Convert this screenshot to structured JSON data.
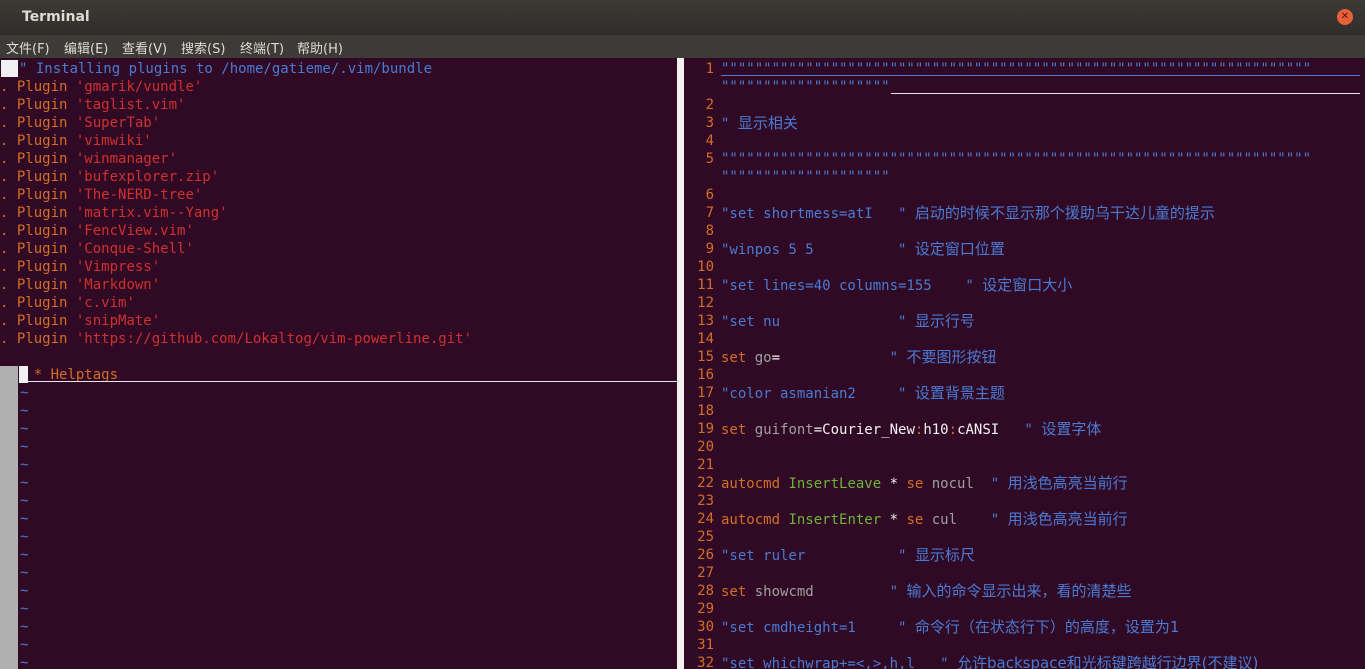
{
  "window": {
    "title": "Terminal"
  },
  "menu": [
    "文件(F)",
    "编辑(E)",
    "查看(V)",
    "搜索(S)",
    "终端(T)",
    "帮助(H)"
  ],
  "left_pane": {
    "header": "\" Installing plugins to /home/gatieme/.vim/bundle",
    "plugins": [
      "'gmarik/vundle'",
      "'taglist.vim'",
      "'SuperTab'",
      "'vimwiki'",
      "'winmanager'",
      "'bufexplorer.zip'",
      "'The-NERD-tree'",
      "'matrix.vim--Yang'",
      "'FencView.vim'",
      "'Conque-Shell'",
      "'Vimpress'",
      "'Markdown'",
      "'c.vim'",
      "'snipMate'",
      "'https://github.com/Lokaltog/vim-powerline.git'"
    ],
    "plugin_prefix": ". ",
    "plugin_keyword": "Plugin",
    "helptags_prefix": "* ",
    "helptags": "Helptags",
    "tilde": "~"
  },
  "right_pane": {
    "sep_a": "\"\"\"\"\"\"\"\"\"\"\"\"\"\"\"\"\"\"\"\"\"\"\"\"\"\"\"\"\"\"\"\"\"\"\"\"\"\"\"\"\"\"\"\"\"\"\"\"\"\"\"\"\"\"\"\"\"\"\"\"\"\"\"\"\"\"\"\"\"\"",
    "sep_b": "\"\"\"\"\"\"\"\"\"\"\"\"\"\"\"\"\"\"\"\"",
    "lines": [
      {
        "n": "1"
      },
      {
        "n": "2"
      },
      {
        "n": "3",
        "code": "\" ",
        "cn": "显示相关"
      },
      {
        "n": "4"
      },
      {
        "n": "5"
      },
      {
        "n": "6"
      },
      {
        "n": "7",
        "code": "\"set shortmess=atI   \" ",
        "cn": "启动的时候不显示那个援助乌干达儿童的提示"
      },
      {
        "n": "8"
      },
      {
        "n": "9",
        "code": "\"winpos 5 5          \" ",
        "cn": "设定窗口位置"
      },
      {
        "n": "10"
      },
      {
        "n": "11",
        "code": "\"set lines=40 columns=155    \" ",
        "cn": "设定窗口大小"
      },
      {
        "n": "12"
      },
      {
        "n": "13",
        "code": "\"set nu              \" ",
        "cn": "显示行号"
      },
      {
        "n": "14"
      },
      {
        "n": "15",
        "k1": "set",
        "k2": " go",
        "k3": "=",
        "code": "             \" ",
        "cn": "不要图形按钮"
      },
      {
        "n": "16"
      },
      {
        "n": "17",
        "code": "\"color asmanian2     \" ",
        "cn": "设置背景主题"
      },
      {
        "n": "18"
      },
      {
        "n": "19",
        "k1": "set",
        "k2": " guifont",
        "k3": "=Courier_New",
        "k4": ":",
        "k5": "h10",
        "k6": ":",
        "k7": "cANSI",
        "code": "   \" ",
        "cn": "设置字体"
      },
      {
        "n": "20"
      },
      {
        "n": "21"
      },
      {
        "n": "22",
        "a1": "autocmd",
        "a2": " InsertLeave",
        "a3": " * ",
        "a4": "se",
        "a5": " nocul",
        "code": "  \" ",
        "cn": "用浅色高亮当前行"
      },
      {
        "n": "23"
      },
      {
        "n": "24",
        "a1": "autocmd",
        "a2": " InsertEnter",
        "a3": " * ",
        "a4": "se",
        "a5": " cul",
        "code": "    \" ",
        "cn": "用浅色高亮当前行"
      },
      {
        "n": "25"
      },
      {
        "n": "26",
        "code": "\"set ruler           \" ",
        "cn": "显示标尺"
      },
      {
        "n": "27"
      },
      {
        "n": "28",
        "k1": "set",
        "k2": " showcmd",
        "code": "         \" ",
        "cn": "输入的命令显示出来，看的清楚些"
      },
      {
        "n": "29"
      },
      {
        "n": "30",
        "code": "\"set cmdheight=1     \" ",
        "cn": "命令行（在状态行下）的高度，设置为1"
      },
      {
        "n": "31"
      },
      {
        "n": "32",
        "code": "\"set whichwrap+=<,>,h,l   \" ",
        "cn": "允许backspace和光标键跨越行边界(不建议)"
      }
    ]
  }
}
